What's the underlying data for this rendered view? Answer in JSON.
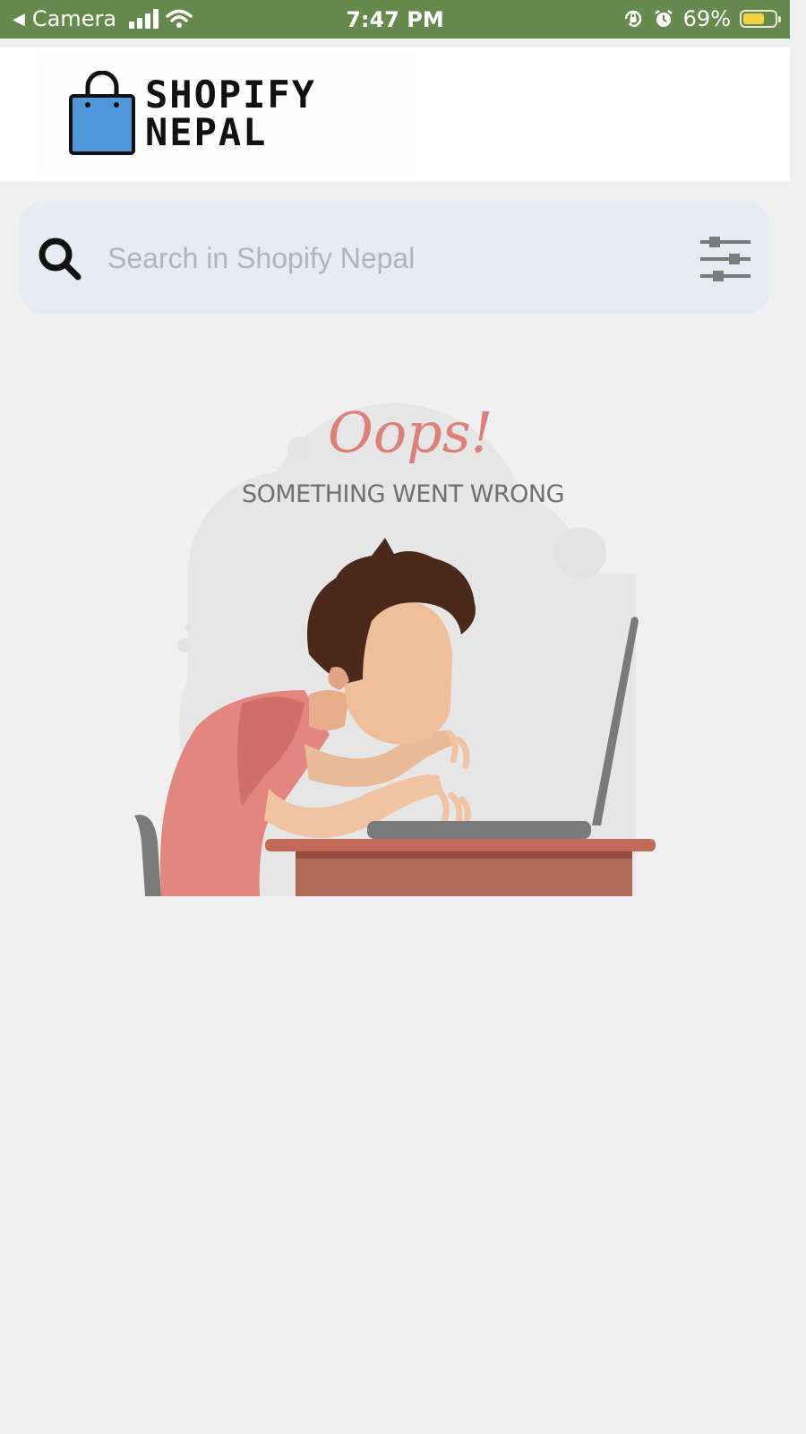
{
  "status_bar": {
    "back_app": "Camera",
    "time": "7:47 PM",
    "battery_percent": "69%",
    "battery_level": 0.69,
    "background_color": "#668a4e",
    "icons": [
      "back-arrow-icon",
      "signal-icon",
      "wifi-icon",
      "rotation-lock-icon",
      "alarm-icon",
      "battery-icon"
    ]
  },
  "header": {
    "logo_text": "SHOPIFY NEPAL",
    "logo_line1": "SHOPIFY",
    "logo_line2": "NEPAL",
    "logo_icon": "shopping-bag-icon",
    "bag_color": "#4f97d8"
  },
  "search": {
    "placeholder": "Search in Shopify Nepal",
    "value": "",
    "search_icon": "search-icon",
    "filter_icon": "filter-sliders-icon",
    "background_color": "#e8ebf3"
  },
  "error": {
    "title": "Oops!",
    "message": "SOMETHING WENT WRONG",
    "title_color": "#de7f7a",
    "illustration": "frustrated-person-at-laptop-illustration"
  }
}
